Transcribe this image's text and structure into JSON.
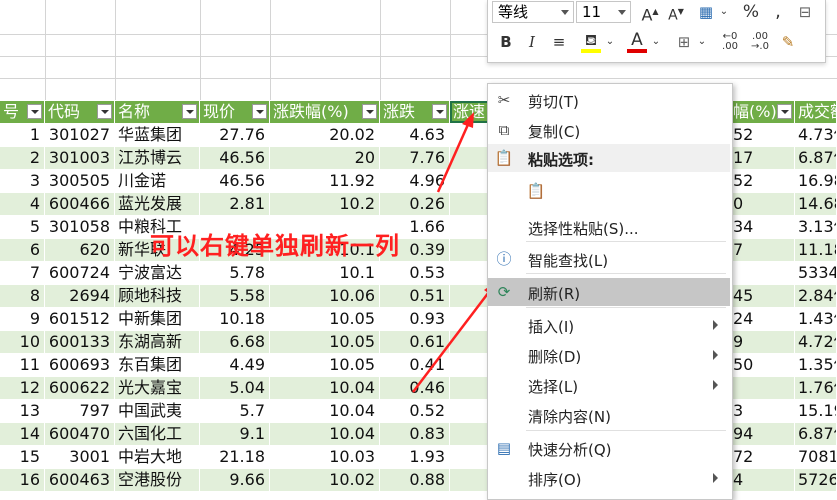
{
  "columns": [
    {
      "label": "号"
    },
    {
      "label": "代码"
    },
    {
      "label": "名称"
    },
    {
      "label": "现价"
    },
    {
      "label": "涨跌幅(%)"
    },
    {
      "label": "涨跌"
    },
    {
      "label": "涨速"
    }
  ],
  "right_columns": [
    {
      "label": "幅(%)"
    },
    {
      "label": "成交额"
    }
  ],
  "rows": [
    {
      "n": "1",
      "code": "301027",
      "name": "华蓝集团",
      "price": "27.76",
      "pct": "20.02",
      "chg": "4.63",
      "r1": "52",
      "r2": "4.73亿"
    },
    {
      "n": "2",
      "code": "301003",
      "name": "江苏博云",
      "price": "46.56",
      "pct": "20",
      "chg": "7.76",
      "r1": "17",
      "r2": "6.87亿"
    },
    {
      "n": "3",
      "code": "300505",
      "name": "川金诺",
      "price": "46.56",
      "pct": "11.92",
      "chg": "4.96",
      "r1": "52",
      "r2": "16.98"
    },
    {
      "n": "4",
      "code": "600466",
      "name": "蓝光发展",
      "price": "2.81",
      "pct": "10.2",
      "chg": "0.26",
      "r1": "0",
      "r2": "14.68"
    },
    {
      "n": "5",
      "code": "301058",
      "name": "中粮科工",
      "price": "",
      "pct": "",
      "chg": "1.66",
      "r1": "34",
      "r2": "3.13亿"
    },
    {
      "n": "6",
      "code": "620",
      "name": "新华联",
      "price": "4.25",
      "pct": "10.1",
      "chg": "0.39",
      "r1": "7",
      "r2": "11.18"
    },
    {
      "n": "7",
      "code": "600724",
      "name": "宁波富达",
      "price": "5.78",
      "pct": "10.1",
      "chg": "0.53",
      "r1": "",
      "r2": "5334."
    },
    {
      "n": "8",
      "code": "2694",
      "name": "顾地科技",
      "price": "5.58",
      "pct": "10.06",
      "chg": "0.51",
      "r1": "45",
      "r2": "2.84亿"
    },
    {
      "n": "9",
      "code": "601512",
      "name": "中新集团",
      "price": "10.18",
      "pct": "10.05",
      "chg": "0.93",
      "r1": "24",
      "r2": "1.43亿"
    },
    {
      "n": "10",
      "code": "600133",
      "name": "东湖高新",
      "price": "6.68",
      "pct": "10.05",
      "chg": "0.61",
      "r1": "9",
      "r2": "4.72亿"
    },
    {
      "n": "11",
      "code": "600693",
      "name": "东百集团",
      "price": "4.49",
      "pct": "10.05",
      "chg": "0.41",
      "r1": "50",
      "r2": "1.35亿"
    },
    {
      "n": "12",
      "code": "600622",
      "name": "光大嘉宝",
      "price": "5.04",
      "pct": "10.04",
      "chg": "0.46",
      "r1": "",
      "r2": "1.76亿"
    },
    {
      "n": "13",
      "code": "797",
      "name": "中国武夷",
      "price": "5.7",
      "pct": "10.04",
      "chg": "0.52",
      "r1": "3",
      "r2": "15.19"
    },
    {
      "n": "14",
      "code": "600470",
      "name": "六国化工",
      "price": "9.1",
      "pct": "10.04",
      "chg": "0.83",
      "r1": "94",
      "r2": "6.87亿"
    },
    {
      "n": "15",
      "code": "3001",
      "name": "中岩大地",
      "price": "21.18",
      "pct": "10.03",
      "chg": "1.93",
      "r1": "72",
      "r2": "7081."
    },
    {
      "n": "16",
      "code": "600463",
      "name": "空港股份",
      "price": "9.66",
      "pct": "10.02",
      "chg": "0.88",
      "r1": "4",
      "r2": "5726."
    }
  ],
  "minitoolbar": {
    "font_name": "等线",
    "font_size": "11",
    "bold": "B",
    "italic": "I",
    "font_color_letter": "A",
    "percent": "%",
    "grow_font": "A",
    "shrink_font": "A"
  },
  "context_menu": {
    "cut": "剪切(T)",
    "copy": "复制(C)",
    "paste_options": "粘贴选项:",
    "paste_special": "选择性粘贴(S)...",
    "smart_lookup": "智能查找(L)",
    "refresh": "刷新(R)",
    "insert": "插入(I)",
    "delete": "删除(D)",
    "select": "选择(L)",
    "clear_contents": "清除内容(N)",
    "quick_analysis": "快速分析(Q)",
    "sort": "排序(O)"
  },
  "annotation": "可以右键单独刷新一列",
  "colors": {
    "header_green": "#70ad47",
    "band_green": "#e2efda",
    "annotation_red": "#ff2020",
    "menu_highlight": "#c6c6c6"
  }
}
